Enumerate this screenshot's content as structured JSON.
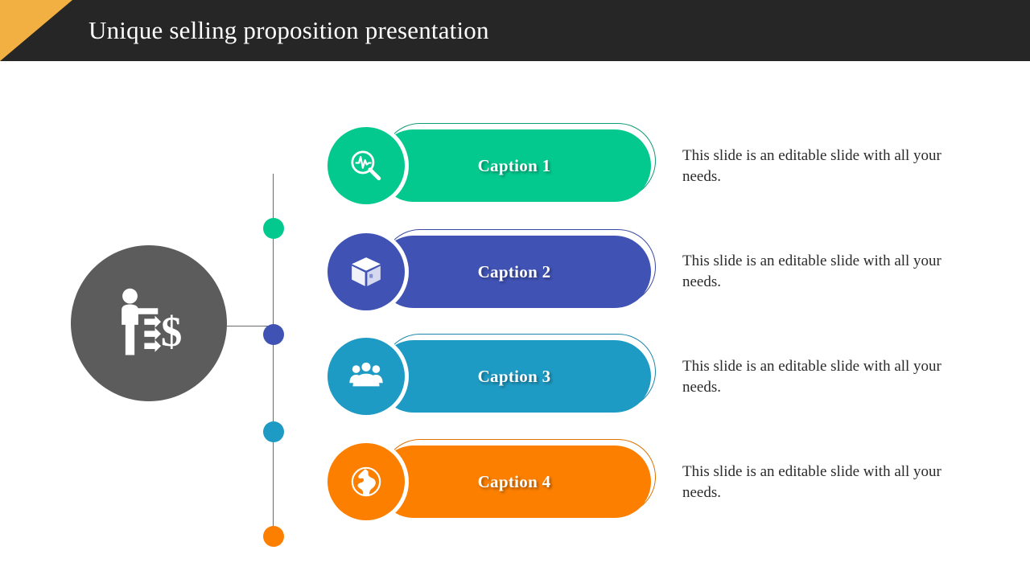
{
  "header": {
    "title": "Unique selling proposition presentation",
    "bar_color": "#262626",
    "corner_color": "#f3b042",
    "title_color": "#ffffff"
  },
  "hub": {
    "label": "central-hub",
    "color": "#5c5c5c",
    "icon": "salesperson-dollar-icon"
  },
  "connector": {
    "line_color": "#6b6b6b"
  },
  "rows": [
    {
      "caption": "Caption 1",
      "description": "This slide is an editable slide with all your needs.",
      "color": "#03c98f",
      "outline_color": "#0f9a75",
      "dot_color": "#03c98f",
      "icon": "magnifier-pulse-icon"
    },
    {
      "caption": "Caption 2",
      "description": "This slide is an editable slide with all your needs.",
      "color": "#4053b5",
      "outline_color": "#3a4aa3",
      "dot_color": "#4053b5",
      "icon": "package-box-icon"
    },
    {
      "caption": "Caption 3",
      "description": "This slide is an editable slide with all your needs.",
      "color": "#1e9bc4",
      "outline_color": "#1b87ab",
      "dot_color": "#1e9bc4",
      "icon": "team-group-icon"
    },
    {
      "caption": "Caption 4",
      "description": "This slide is an editable slide with all your needs.",
      "color": "#fc7f00",
      "outline_color": "#e07200",
      "dot_color": "#fc7f00",
      "icon": "globe-icon"
    }
  ]
}
